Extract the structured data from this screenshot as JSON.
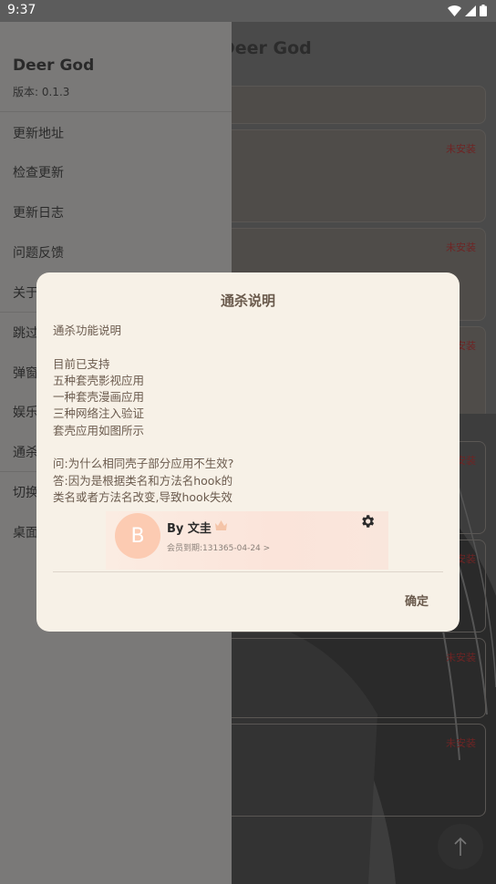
{
  "status_bar": {
    "time": "9:37"
  },
  "background": {
    "title": "Deer God",
    "cards": [
      {
        "status": ""
      },
      {
        "status": "未安装"
      },
      {
        "status": "未安装"
      },
      {
        "status": "未安装"
      },
      {
        "status": "未安装"
      },
      {
        "status": "未安装"
      },
      {
        "status": "未安装"
      },
      {
        "status": "未安装"
      }
    ]
  },
  "drawer": {
    "app_name": "Deer God",
    "version": "版本: 0.1.3",
    "items": [
      {
        "label": "更新地址"
      },
      {
        "label": "检查更新"
      },
      {
        "label": "更新日志"
      },
      {
        "label": "问题反馈"
      },
      {
        "label": "关于"
      },
      {
        "label": "跳过"
      },
      {
        "label": "弹窗"
      },
      {
        "label": "娱乐"
      },
      {
        "label": "通杀"
      },
      {
        "label": "切换"
      },
      {
        "label": "桌面"
      }
    ]
  },
  "dialog": {
    "title": "通杀说明",
    "lines": [
      "通杀功能说明",
      "",
      "目前已支持",
      "五种套壳影视应用",
      "一种套壳漫画应用",
      "三种网络注入验证",
      "套壳应用如图所示",
      "",
      "问:为什么相同壳子部分应用不生效?",
      "答:因为是根据类名和方法名hook的",
      "类名或者方法名改变,导致hook失效"
    ],
    "vip_card": {
      "avatar_letter": "B",
      "name": "By 文圭",
      "expiry": "会员到期:131365-04-24 >"
    },
    "confirm_label": "确定"
  }
}
